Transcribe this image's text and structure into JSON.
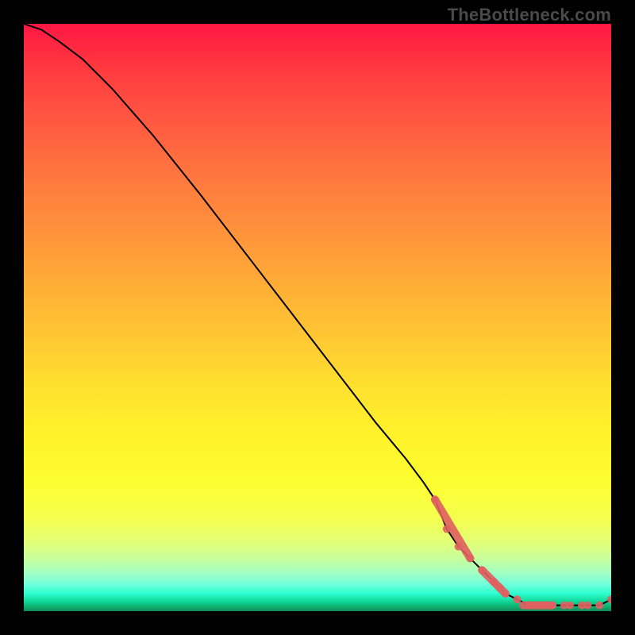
{
  "watermark": "TheBottleneck.com",
  "chart_data": {
    "type": "line",
    "title": "",
    "xlabel": "",
    "ylabel": "",
    "xlim": [
      0,
      100
    ],
    "ylim": [
      0,
      100
    ],
    "grid": false,
    "series": [
      {
        "name": "curve",
        "x": [
          0,
          3,
          6,
          10,
          15,
          22,
          30,
          40,
          50,
          60,
          65,
          68,
          70,
          72,
          74,
          76,
          78,
          80,
          82,
          84,
          86,
          88,
          90,
          92,
          94,
          96,
          98,
          100
        ],
        "y": [
          100,
          99,
          97,
          94,
          89,
          81,
          71,
          58,
          45,
          32,
          26,
          22,
          19,
          14,
          11,
          9,
          7,
          5,
          3,
          2,
          1,
          1,
          1,
          1,
          1,
          1,
          1,
          2
        ]
      }
    ],
    "markers": [
      {
        "x": 70,
        "y": 19
      },
      {
        "x": 72,
        "y": 14
      },
      {
        "x": 74,
        "y": 11
      },
      {
        "x": 76,
        "y": 9
      },
      {
        "x": 78,
        "y": 7
      },
      {
        "x": 80,
        "y": 5
      },
      {
        "x": 81,
        "y": 4
      },
      {
        "x": 82,
        "y": 3
      },
      {
        "x": 84,
        "y": 2
      },
      {
        "x": 86,
        "y": 1
      },
      {
        "x": 87,
        "y": 1
      },
      {
        "x": 88,
        "y": 1
      },
      {
        "x": 89,
        "y": 1
      },
      {
        "x": 90,
        "y": 1
      },
      {
        "x": 92,
        "y": 1
      },
      {
        "x": 93,
        "y": 1
      },
      {
        "x": 95,
        "y": 1
      },
      {
        "x": 96,
        "y": 1
      },
      {
        "x": 98,
        "y": 1
      },
      {
        "x": 100,
        "y": 2
      }
    ],
    "dense_segments": [
      {
        "x0": 70,
        "y0": 19,
        "x1": 76,
        "y1": 9
      },
      {
        "x0": 78,
        "y0": 7,
        "x1": 82,
        "y1": 3
      },
      {
        "x0": 85,
        "y0": 1,
        "x1": 90,
        "y1": 1
      }
    ],
    "colors": {
      "curve": "#000000",
      "marker": "#e06060",
      "dense": "#e06060"
    }
  }
}
